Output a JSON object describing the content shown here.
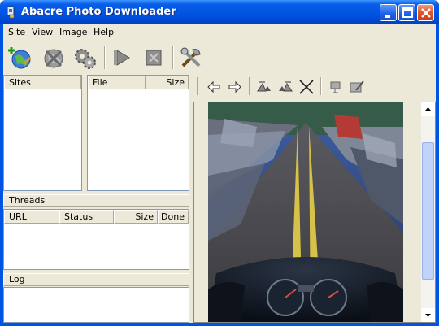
{
  "window": {
    "title": "Abacre Photo Downloader"
  },
  "menu": {
    "items": [
      "Site",
      "View",
      "Image",
      "Help"
    ]
  },
  "toolbar": {
    "tools": [
      "add-site-icon",
      "stop-site-icon",
      "settings-gears-icon",
      "start-icon",
      "stop-icon",
      "tools-icon"
    ]
  },
  "sites": {
    "header": "Sites"
  },
  "files": {
    "columns": [
      "File",
      "Size"
    ]
  },
  "threads": {
    "title": "Threads",
    "columns": [
      "URL",
      "Status",
      "Size",
      "Done"
    ]
  },
  "log": {
    "title": "Log"
  },
  "viewer": {
    "tools": [
      "back-arrow-icon",
      "forward-arrow-icon",
      "rotate-left-icon",
      "rotate-right-icon",
      "delete-icon",
      "slideshow-icon",
      "edit-image-icon"
    ],
    "image_name": "motorcycle-road-photo"
  }
}
